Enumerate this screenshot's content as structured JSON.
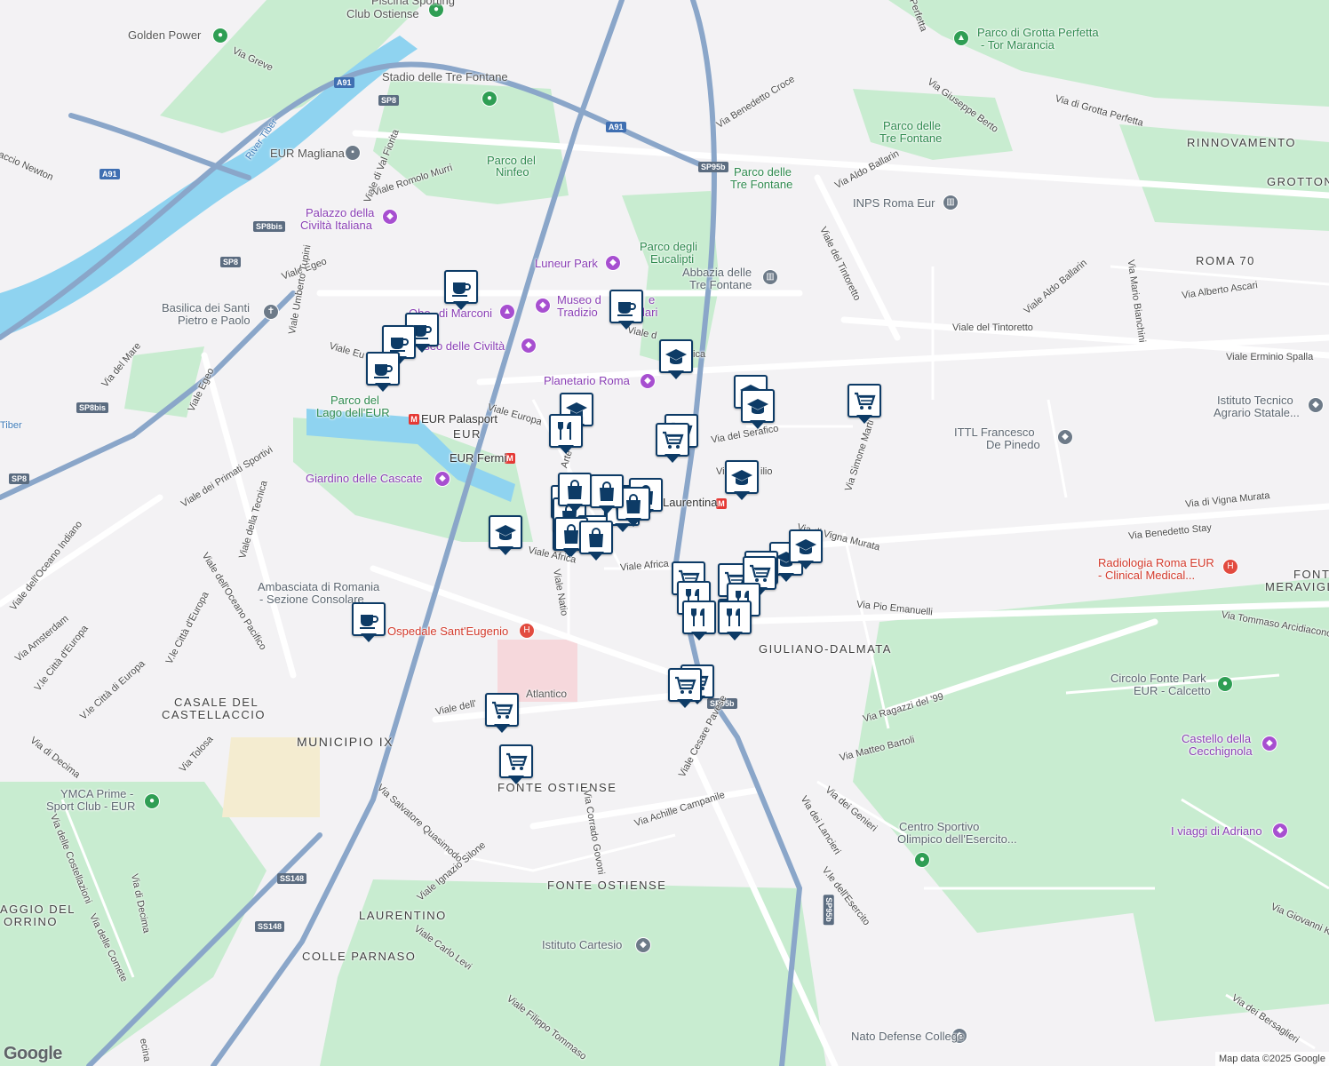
{
  "map": {
    "attribution": "Map data ©2025 Google",
    "logo": "Google",
    "labels": {
      "piscina": "Piscina Sporting",
      "club_ostiense": "Club Ostiense",
      "golden_power": "Golden Power",
      "stadio": "Stadio delle Tre Fontane",
      "eur_magliana": "EUR Magliana",
      "river_tiber": "River Tiber",
      "tiber": "Tiber",
      "via_greve": "Via Greve",
      "accio_newton": "accio Newton",
      "viale_val_fiorita": "Viale di Val Fiorita",
      "viale_romolo_murri": "Viale Romolo Murri",
      "parco_ninfeo_1": "Parco del",
      "parco_ninfeo_2": "Ninfeo",
      "palazzo_1": "Palazzo della",
      "palazzo_2": "Civiltà Italiana",
      "viale_egeo": "Viale Egeo",
      "luneur": "Luneur Park",
      "parco_eucalipti_1": "Parco degli",
      "parco_eucalipti_2": "Eucalipti",
      "abbazia_1": "Abbazia delle",
      "abbazia_2": "Tre Fontane",
      "basilica_1": "Basilica dei Santi",
      "basilica_2": "Pietro e Paolo",
      "museo_trad_1": "Museo d",
      "museo_trad_2": "Tradizio",
      "museo_trad_3": "e",
      "museo_trad_4": "lari",
      "obelisco": "Obe",
      "obelisco2": "di Marconi",
      "museo_civilta": "useo delle Civiltà",
      "viale_umberto_tupini": "Viale Umberto Tupini",
      "via_del_mare": "Via del Mare",
      "viale_eu": "Viale Eu",
      "planetario": "Planetario Roma",
      "viale_della_tecnica": "Viale d",
      "viale_della_tecnica_2": "ca",
      "parco_lago_1": "Parco del",
      "parco_lago_2": "Lago dell'EUR",
      "eur_palasport": "EUR Palasport",
      "eur": "EUR",
      "eur_fermi": "EUR Fermi",
      "viale_europa": "Viale Europa",
      "arte": "Arte",
      "via_serafico": "Via del Serafico",
      "via_silio": "Via",
      "via_silio_2": "ilio",
      "giardino_cascate": "Giardino delle Cascate",
      "laurentina": "Laurentina",
      "viale_primati": "Viale dei Primati Sportivi",
      "viale_egeo_2": "Viale Egeo",
      "viale_tecnica": "Viale della Tecnica",
      "viale_oceano_indiano": "Viale dell'Oceano Indiano",
      "viale_oceano_pacifico": "Viale dell'Oceano Pacifico",
      "viale_africa": "Viale Africa",
      "viale_africa_2": "Viale Africa",
      "viale_natio": "Viale Natio",
      "ambasciata_1": "Ambasciata di Romania",
      "ambasciata_2": "- Sezione Consolare",
      "ospedale": "Ospedale Sant'Eugenio",
      "via_amsterdam": "Via Amsterdam",
      "vle_citta_europa": "V.le Città d'Europa",
      "vle_citta_europa_2": "V.le Città d'Europa",
      "vle_citta_europa_3": "V.le Città di Europa",
      "casale_1": "CASALE DEL",
      "casale_2": "CASTELLACCIO",
      "municipio": "MUNICIPIO IX",
      "viale_atlantico": "Viale dell'",
      "viale_atlantico_2": "Atlantico",
      "via_di_decima": "Via di Decima",
      "via_di_decima_2": "Via di Decima",
      "via_tolosa": "Via Tolosa",
      "ymca_1": "YMCA Prime -",
      "ymca_2": "Sport Club - EUR",
      "via_costellazioni": "Via delle Costellazioni",
      "via_quasimodo": "Via Salvatore Quasimodo",
      "fonte_ostiense_1": "FONTE OSTIENSE",
      "fonte_ostiense_2": "FONTE OSTIENSE",
      "via_corrado_govoni": "Via Corrado Govoni",
      "viale_cesare_pavese": "Viale Cesare Pavese",
      "via_achille_campanile": "Via Achille Campanile",
      "viale_ignazio_silone": "Viale Ignazio Silone",
      "laurentino": "LAURENTINO",
      "colle_parnaso": "COLLE PARNASO",
      "viale_carlo_levi": "Viale Carlo Levi",
      "istituto_cartesio": "Istituto Cartesio",
      "viale_filippo": "Viale Filippo Tommaso",
      "aggio_del_1": "AGGIO DEL",
      "aggio_del_2": "ORRINO",
      "via_delle_comete": "Via delle Comete",
      "ecina": "ecina",
      "via_perfetta": "Perfetta",
      "parco_grotta_1": "Parco di Grotta Perfetta",
      "parco_grotta_2": "- Tor Marancia",
      "via_benedetto_croce": "Via Benedetto Croce",
      "via_giuseppe_berto": "Via Giuseppe Berto",
      "via_grotta_perfetta": "Via di Grotta Perfetta",
      "parco_tre_fontane_1": "Parco delle",
      "parco_tre_fontane_2": "Tre Fontane",
      "parco_tre_fontane_3": "Parco delle",
      "parco_tre_fontane_4": "Tre Fontane",
      "rinnovamento": "RINNOVAMENTO",
      "grotton": "GROTTON",
      "via_aldo_ballarin": "Via Aldo Ballarin",
      "via_aldo_ballarin_2": "Viale Aldo Ballarin",
      "inps": "INPS Roma Eur",
      "viale_tintoretto": "Viale del Tintoretto",
      "viale_tintoretto_2": "Viale del Tintoretto",
      "roma_70": "ROMA 70",
      "via_alberto_ascari": "Via Alberto Ascari",
      "via_mario_bianchini": "Via Mario Bianchini",
      "viale_erminio_spalla": "Viale Erminio Spalla",
      "istituto_tecnico_1": "Istituto Tecnico",
      "istituto_tecnico_2": "Agrario Statale...",
      "ittl_1": "ITTL Francesco",
      "ittl_2": "De Pinedo",
      "via_simone_martini": "Via Simone Marti",
      "via_vigna_murata": "Via di Vigna Murata",
      "via_vigna_murata_2": "Via di Vigna Murata",
      "via_benedetto_stay": "Via Benedetto Stay",
      "radiologia_1": "Radiologia Roma EUR",
      "radiologia_2": "- Clinical Medical...",
      "fonte_meravigl_1": "FONT",
      "fonte_meravigl_2": "MERAVIGL",
      "via_pio_emanuelli": "Via Pio Emanuelli",
      "via_tommaso": "Via Tommaso Arcidiacono",
      "giuliano": "GIULIANO-DALMATA",
      "circolo_1": "Circolo Fonte Park",
      "circolo_2": "EUR - Calcetto",
      "via_ragazzi": "Via Ragazzi del '99",
      "via_matteo_bartoli": "Via Matteo Bartoli",
      "castello_1": "Castello della",
      "castello_2": "Cecchignola",
      "via_dei_genieri": "Via dei Genieri",
      "via_dei_lancieri": "Via dei Lancieri",
      "centro_sportivo_1": "Centro Sportivo",
      "centro_sportivo_2": "Olimpico dell'Esercito...",
      "viaggi_adriano": "I viaggi di Adriano",
      "vle_esercito": "V.le dell'Esercito",
      "via_giovanni": "Via Giovanni K",
      "nato": "Nato Defense College",
      "via_bersaglieri": "Via dei Bersaglieri",
      "viale_della_musica": "Viale d",
      "viale_della_musica_2": "ica",
      "viale_ac": "Viale Ac"
    },
    "road_badges": {
      "a91_1": "A91",
      "a91_2": "A91",
      "a91_3": "A91",
      "sp8_1": "SP8",
      "sp8_2": "SP8",
      "sp8_3": "SP8",
      "sp8bis_1": "SP8bis",
      "sp8bis_2": "SP8bis",
      "sp95b_1": "SP95b",
      "sp95b_2": "SP95b",
      "sp95b_3": "SP95b",
      "ss148_1": "SS148",
      "ss148_2": "SS148"
    },
    "metro_symbol": "M",
    "marker_types": [
      "coffee",
      "school",
      "cart",
      "restaurant",
      "shopping"
    ],
    "colors": {
      "background": "#f3f2f4",
      "park": "#c8ecd0",
      "water": "#8fd3f0",
      "highway": "#8aa6c9",
      "major_road": "#ffffff",
      "marker_border": "#0d3b66",
      "poi_purple": "#a74fd0",
      "medical_red": "#e24b3f"
    }
  }
}
